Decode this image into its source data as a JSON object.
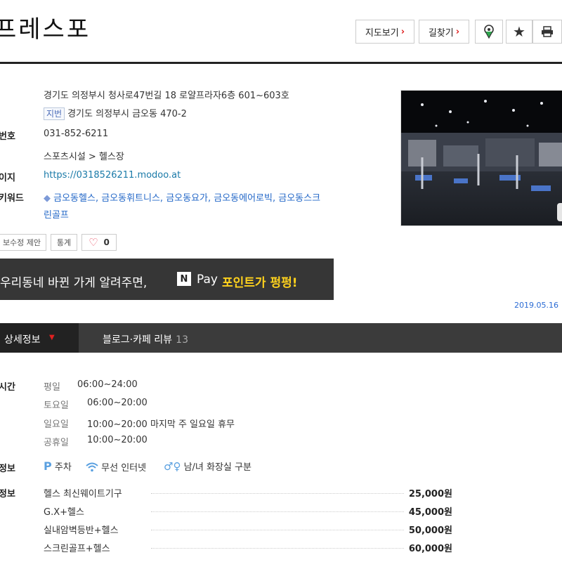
{
  "header": {
    "title": "프레스포",
    "buttons": {
      "map": "지도보기",
      "directions": "길찾기"
    }
  },
  "info": {
    "address": "경기도 의정부시 청사로47번길 18 로얄프라자6층 601~603호",
    "lot_badge": "지번",
    "lot_address": "경기도 의정부시 금오동 470-2",
    "phone_label": "번호",
    "phone": "031-852-6211",
    "category": "스포츠시설 > 헬스장",
    "homepage_label": "이지",
    "homepage": "https://0318526211.modoo.at",
    "keywords_label": "키워드",
    "keywords_line1": "금오동헬스, 금오동휘트니스, 금오동요가, 금오동에어로빅, 금오동스크",
    "keywords_line2": "린골프",
    "suggest_edit": "보수정 제안",
    "stats": "통계",
    "likes": "0"
  },
  "banner": {
    "text": "우리동네 바뀐 가게 알려주면,",
    "logo": "N",
    "pay": "Pay",
    "point": "포인트가 펑펑!"
  },
  "date": "2019.05.16",
  "tabs": {
    "detail": "상세정보",
    "blog": "블로그·카페 리뷰",
    "blog_count": "13"
  },
  "hours": {
    "label": "시간",
    "rows": [
      {
        "day": "평일",
        "time": "06:00~24:00"
      },
      {
        "day": "토요일",
        "time": "06:00~20:00"
      },
      {
        "day": "일요일",
        "time": "10:00~20:00 마지막 주 일요일 휴무"
      },
      {
        "day": "공휴일",
        "time": "10:00~20:00"
      }
    ]
  },
  "amenities": {
    "label": "정보",
    "items": [
      "주차",
      "무선 인터넷",
      "남/녀 화장실 구분"
    ]
  },
  "menu": {
    "label": "정보",
    "items": [
      {
        "name": "헬스 최신웨이트기구",
        "price": "25,000원"
      },
      {
        "name": "G.X+헬스",
        "price": "45,000원"
      },
      {
        "name": "실내암벽등반+헬스",
        "price": "50,000원"
      },
      {
        "name": "스크린골프+헬스",
        "price": "60,000원"
      }
    ]
  },
  "colors": {
    "accent_red": "#e02020",
    "link_blue": "#2468c8",
    "tab_bar": "#3b3b3b",
    "banner_yellow": "#ffd21d"
  }
}
